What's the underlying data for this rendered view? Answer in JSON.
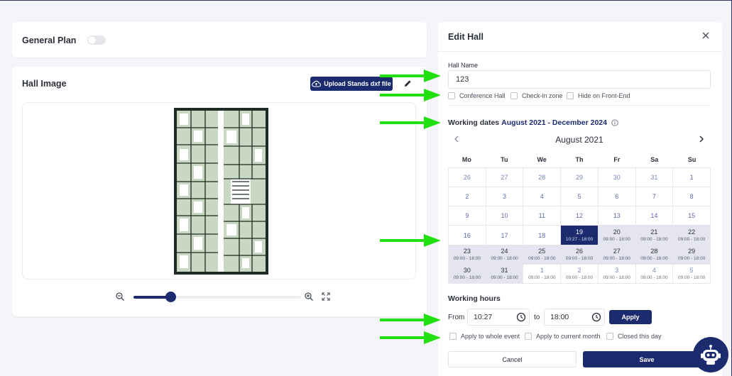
{
  "general_plan": {
    "title": "General Plan"
  },
  "hall_image": {
    "title": "Hall Image",
    "upload_label": "Upload Stands dxf file",
    "zoom_level": 0.22
  },
  "edit_hall": {
    "title": "Edit Hall",
    "hall_name_label": "Hall Name",
    "hall_name_value": "123",
    "checkboxes": [
      "Conference Hall",
      "Check-in zone",
      "Hide on Front-End"
    ],
    "working_dates_label": "Working dates",
    "working_dates_range": "August 2021 - December 2024",
    "calendar": {
      "month": "August 2021",
      "weekdays": [
        "Mo",
        "Tu",
        "We",
        "Th",
        "Fr",
        "Sa",
        "Su"
      ],
      "days": [
        {
          "d": "26",
          "t": "",
          "s": "muted"
        },
        {
          "d": "27",
          "t": "",
          "s": "muted"
        },
        {
          "d": "28",
          "t": "",
          "s": "muted"
        },
        {
          "d": "29",
          "t": "",
          "s": "muted"
        },
        {
          "d": "30",
          "t": "",
          "s": "muted"
        },
        {
          "d": "31",
          "t": "",
          "s": "muted"
        },
        {
          "d": "1",
          "t": "",
          "s": "plain"
        },
        {
          "d": "2",
          "t": "",
          "s": "plain"
        },
        {
          "d": "3",
          "t": "",
          "s": "plain"
        },
        {
          "d": "4",
          "t": "",
          "s": "plain"
        },
        {
          "d": "5",
          "t": "",
          "s": "plain"
        },
        {
          "d": "6",
          "t": "",
          "s": "plain"
        },
        {
          "d": "7",
          "t": "",
          "s": "plain"
        },
        {
          "d": "8",
          "t": "",
          "s": "plain"
        },
        {
          "d": "9",
          "t": "",
          "s": "plain"
        },
        {
          "d": "10",
          "t": "",
          "s": "plain"
        },
        {
          "d": "11",
          "t": "",
          "s": "plain"
        },
        {
          "d": "12",
          "t": "",
          "s": "plain"
        },
        {
          "d": "13",
          "t": "",
          "s": "plain"
        },
        {
          "d": "14",
          "t": "",
          "s": "plain"
        },
        {
          "d": "15",
          "t": "",
          "s": "plain"
        },
        {
          "d": "16",
          "t": "",
          "s": "plain"
        },
        {
          "d": "17",
          "t": "",
          "s": "plain"
        },
        {
          "d": "18",
          "t": "",
          "s": "plain"
        },
        {
          "d": "19",
          "t": "10:27 - 18:00",
          "s": "sel"
        },
        {
          "d": "20",
          "t": "09:00 - 18:00",
          "s": "work"
        },
        {
          "d": "21",
          "t": "09:00 - 18:00",
          "s": "work"
        },
        {
          "d": "22",
          "t": "09:00 - 18:00",
          "s": "work"
        },
        {
          "d": "23",
          "t": "09:00 - 18:00",
          "s": "work"
        },
        {
          "d": "24",
          "t": "09:00 - 18:00",
          "s": "work"
        },
        {
          "d": "25",
          "t": "09:00 - 18:00",
          "s": "work"
        },
        {
          "d": "26",
          "t": "09:00 - 18:00",
          "s": "work"
        },
        {
          "d": "27",
          "t": "09:00 - 18:00",
          "s": "work"
        },
        {
          "d": "28",
          "t": "09:00 - 18:00",
          "s": "work"
        },
        {
          "d": "29",
          "t": "09:00 - 18:00",
          "s": "work"
        },
        {
          "d": "30",
          "t": "09:00 - 18:00",
          "s": "work"
        },
        {
          "d": "31",
          "t": "09:00 - 18:00",
          "s": "work"
        },
        {
          "d": "1",
          "t": "09:00 - 18:00",
          "s": "muted"
        },
        {
          "d": "2",
          "t": "09:00 - 18:00",
          "s": "muted"
        },
        {
          "d": "3",
          "t": "09:00 - 18:00",
          "s": "muted"
        },
        {
          "d": "4",
          "t": "09:00 - 18:00",
          "s": "muted"
        },
        {
          "d": "5",
          "t": "09:00 - 18:00",
          "s": "muted"
        }
      ]
    },
    "working_hours": {
      "title": "Working hours",
      "from_label": "From",
      "from_value": "10:27",
      "to_label": "to",
      "to_value": "18:00",
      "apply_label": "Apply"
    },
    "apply_options": [
      "Apply to whole event",
      "Apply to current month",
      "Closed this day"
    ],
    "cancel_label": "Cancel",
    "save_label": "Save"
  },
  "colors": {
    "primary": "#1c2a6e",
    "arrow": "#22e010",
    "working_day": "#e4e5f1"
  }
}
